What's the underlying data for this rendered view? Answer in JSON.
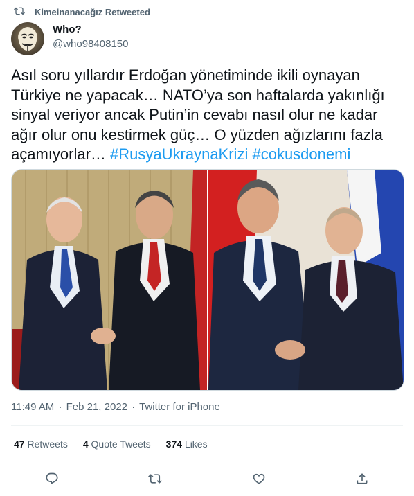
{
  "retweet": {
    "label": "Kimeinanacağız Retweeted"
  },
  "author": {
    "name": "Who?",
    "handle": "@who98408150"
  },
  "tweet": {
    "text": "Asıl soru yıllardır Erdoğan yönetiminde ikili oynayan Türkiye ne yapacak… NATO’ya son haftalarda yakınlığı sinyal veriyor ancak Putin’in cevabı nasıl olur ne kadar ağır olur onu kestirmek güç… O yüzden ağızlarını fazla açamıyorlar… ",
    "hashtags": [
      "#RusyaUkraynaKrizi",
      "#cokusdonemi"
    ]
  },
  "meta": {
    "time": "11:49 AM",
    "date": "Feb 21, 2022",
    "source": "Twitter for iPhone",
    "separator": "·"
  },
  "stats": {
    "retweets_count": "47",
    "retweets_label": "Retweets",
    "quotes_count": "4",
    "quotes_label": "Quote Tweets",
    "likes_count": "374",
    "likes_label": "Likes"
  },
  "icons": {
    "retweet": "retweet-icon",
    "reply": "reply-icon",
    "like": "heart-icon",
    "share": "share-icon"
  },
  "colors": {
    "link": "#1d9bf0",
    "secondary": "#536471",
    "text": "#0f1419"
  }
}
